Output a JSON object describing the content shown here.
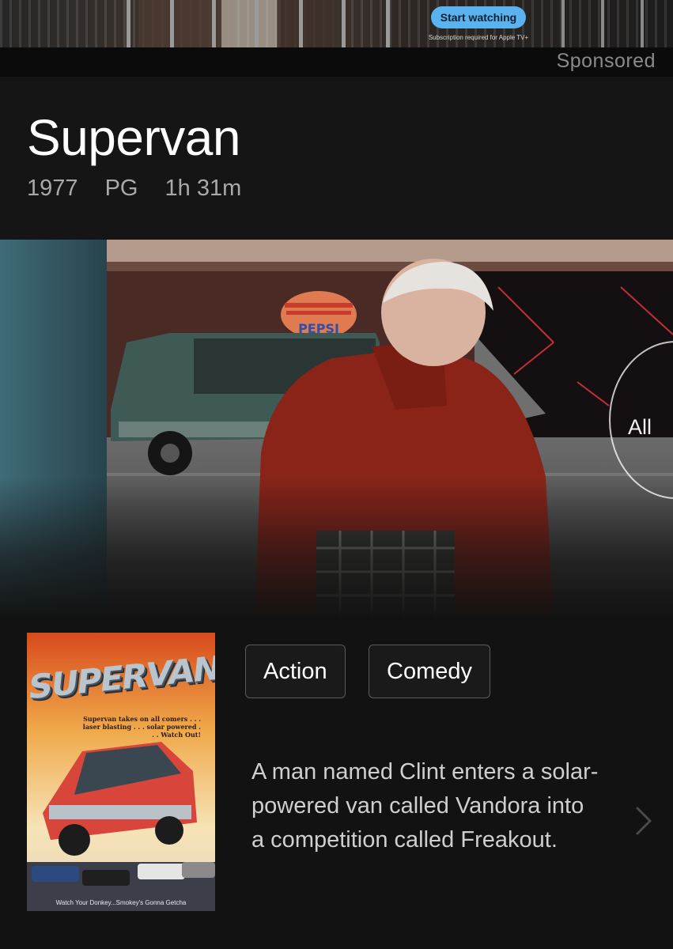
{
  "ad": {
    "cta_label": "Start watching",
    "fine_print": "Subscription required for Apple TV+",
    "sponsored_label": "Sponsored"
  },
  "movie": {
    "title": "Supervan",
    "year": "1977",
    "rating": "PG",
    "runtime": "1h 31m",
    "genres": [
      "Action",
      "Comedy"
    ],
    "synopsis": "A man named Clint enters a solar-powered van called Vandora into a competition called Freakout."
  },
  "hero": {
    "all_label": "All",
    "sign_text": "PEPSI"
  },
  "poster": {
    "title": "SUPERVAN",
    "tagline": "Supervan takes on all comers . . . laser blasting . . . solar powered . . . Watch Out!",
    "bottom_line": "Watch Your Donkey...Smokey's Gonna Getcha"
  },
  "icons": {
    "chevron": "chevron-right-icon"
  }
}
